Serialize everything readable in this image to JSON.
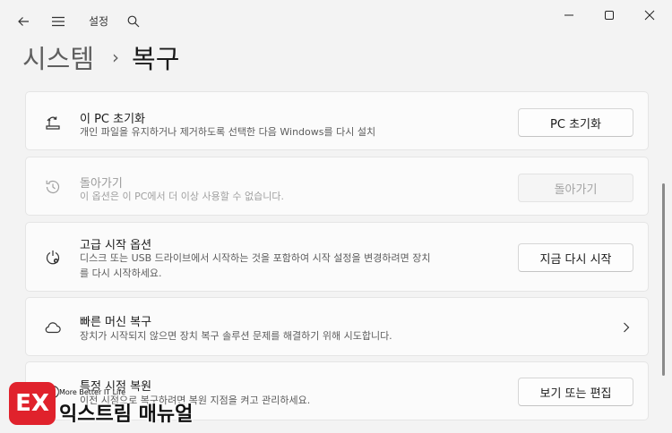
{
  "app": {
    "title": "설정"
  },
  "breadcrumb": {
    "parent": "시스템",
    "separator": "›",
    "current": "복구"
  },
  "cards": [
    {
      "title": "이 PC 초기화",
      "description": "개인 파일을 유지하거나 제거하도록 선택한 다음 Windows를 다시 설치",
      "button": "PC 초기화",
      "icon": "reset-pc-icon",
      "enabled": true
    },
    {
      "title": "돌아가기",
      "description": "이 옵션은 이 PC에서 더 이상 사용할 수 없습니다.",
      "button": "돌아가기",
      "icon": "history-icon",
      "enabled": false
    },
    {
      "title": "고급 시작 옵션",
      "description_line1": "디스크 또는 USB 드라이브에서 시작하는 것을 포함하여 시작 설정을 변경하려면 장치",
      "description_line2": "를 다시 시작하세요.",
      "button": "지금 다시 시작",
      "icon": "advanced-startup-icon",
      "enabled": true
    },
    {
      "title": "빠른 머신 복구",
      "description": "장치가 시작되지 않으면 장치 복구 솔루션 문제를 해결하기 위해 시도합니다.",
      "icon": "cloud-icon",
      "enabled": true
    },
    {
      "title": "특정 시점 복원",
      "description": "이전 시점으로 복구하려면 복원 지점을 켜고 관리하세요.",
      "button": "보기 또는 편집",
      "icon": "restore-point-icon",
      "enabled": true
    }
  ],
  "watermark": {
    "logo": "EX",
    "subtitle": "More Better IT Life",
    "name": "익스트림 매뉴얼"
  }
}
